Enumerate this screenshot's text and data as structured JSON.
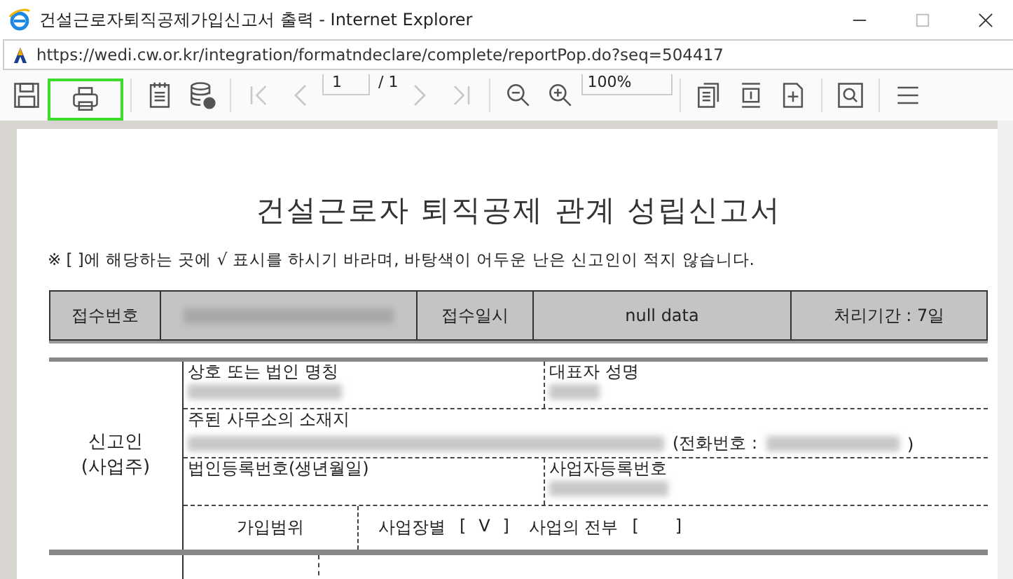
{
  "window": {
    "title": "건설근로자퇴직공제가입신고서 출력 - Internet Explorer",
    "address": "https://wedi.cw.or.kr/integration/formatndeclare/complete/reportPop.do?seq=504417"
  },
  "toolbar": {
    "buttons": [
      {
        "kind": "save",
        "highlighted": false,
        "disabled": false
      },
      {
        "kind": "print",
        "highlighted": true,
        "disabled": false
      },
      {
        "kind": "sep"
      },
      {
        "kind": "notepad",
        "highlighted": false,
        "disabled": false
      },
      {
        "kind": "export",
        "highlighted": false,
        "disabled": false
      },
      {
        "kind": "sep"
      },
      {
        "kind": "first",
        "highlighted": false,
        "disabled": true
      },
      {
        "kind": "prev",
        "highlighted": false,
        "disabled": true
      },
      {
        "kind": "page"
      },
      {
        "kind": "next",
        "highlighted": false,
        "disabled": true
      },
      {
        "kind": "last",
        "highlighted": false,
        "disabled": true
      },
      {
        "kind": "sep"
      },
      {
        "kind": "zoomout",
        "highlighted": false,
        "disabled": false
      },
      {
        "kind": "zoomin",
        "highlighted": false,
        "disabled": false
      },
      {
        "kind": "zoom"
      },
      {
        "kind": "sep"
      },
      {
        "kind": "pages",
        "highlighted": false,
        "disabled": false
      },
      {
        "kind": "fitheight",
        "highlighted": false,
        "disabled": false
      },
      {
        "kind": "fitpage",
        "highlighted": false,
        "disabled": false
      },
      {
        "kind": "sep"
      },
      {
        "kind": "find",
        "highlighted": false,
        "disabled": false
      },
      {
        "kind": "sep"
      },
      {
        "kind": "menu",
        "highlighted": false,
        "disabled": false
      }
    ],
    "page": "1",
    "page_total": "/ 1",
    "zoom": "100%"
  },
  "document": {
    "title": "건설근로자 퇴직공제 관계 성립신고서",
    "notice": "※ [ ]에 해당하는 곳에 √ 표시를 하시기 바라며, 바탕색이 어두운 난은 신고인이 적지 않습니다.",
    "header": {
      "receipt_no_label": "접수번호",
      "receipt_date_label": "접수일시",
      "receipt_date": "null data",
      "period": "처리기간 : 7일"
    },
    "applicant": {
      "label": [
        "신고인",
        "(사업주)"
      ],
      "company_name_label": "상호 또는 법인 명칭",
      "representative_label": "대표자 성명",
      "address_label": "주된 사무소의 소재지",
      "phone_label": "(전화번호 :",
      "phone_close": ")",
      "corp_no_label": "법인등록번호(생년월일)",
      "biz_no_label": "사업자등록번호",
      "scope_label": "가입범위",
      "scope_options": [
        {
          "label": "사업장별",
          "open": "[",
          "mark": "V",
          "close": "]",
          "checked": true
        },
        {
          "label": "사업의 전부",
          "open": "[",
          "close": "]",
          "checked": false
        }
      ]
    }
  }
}
